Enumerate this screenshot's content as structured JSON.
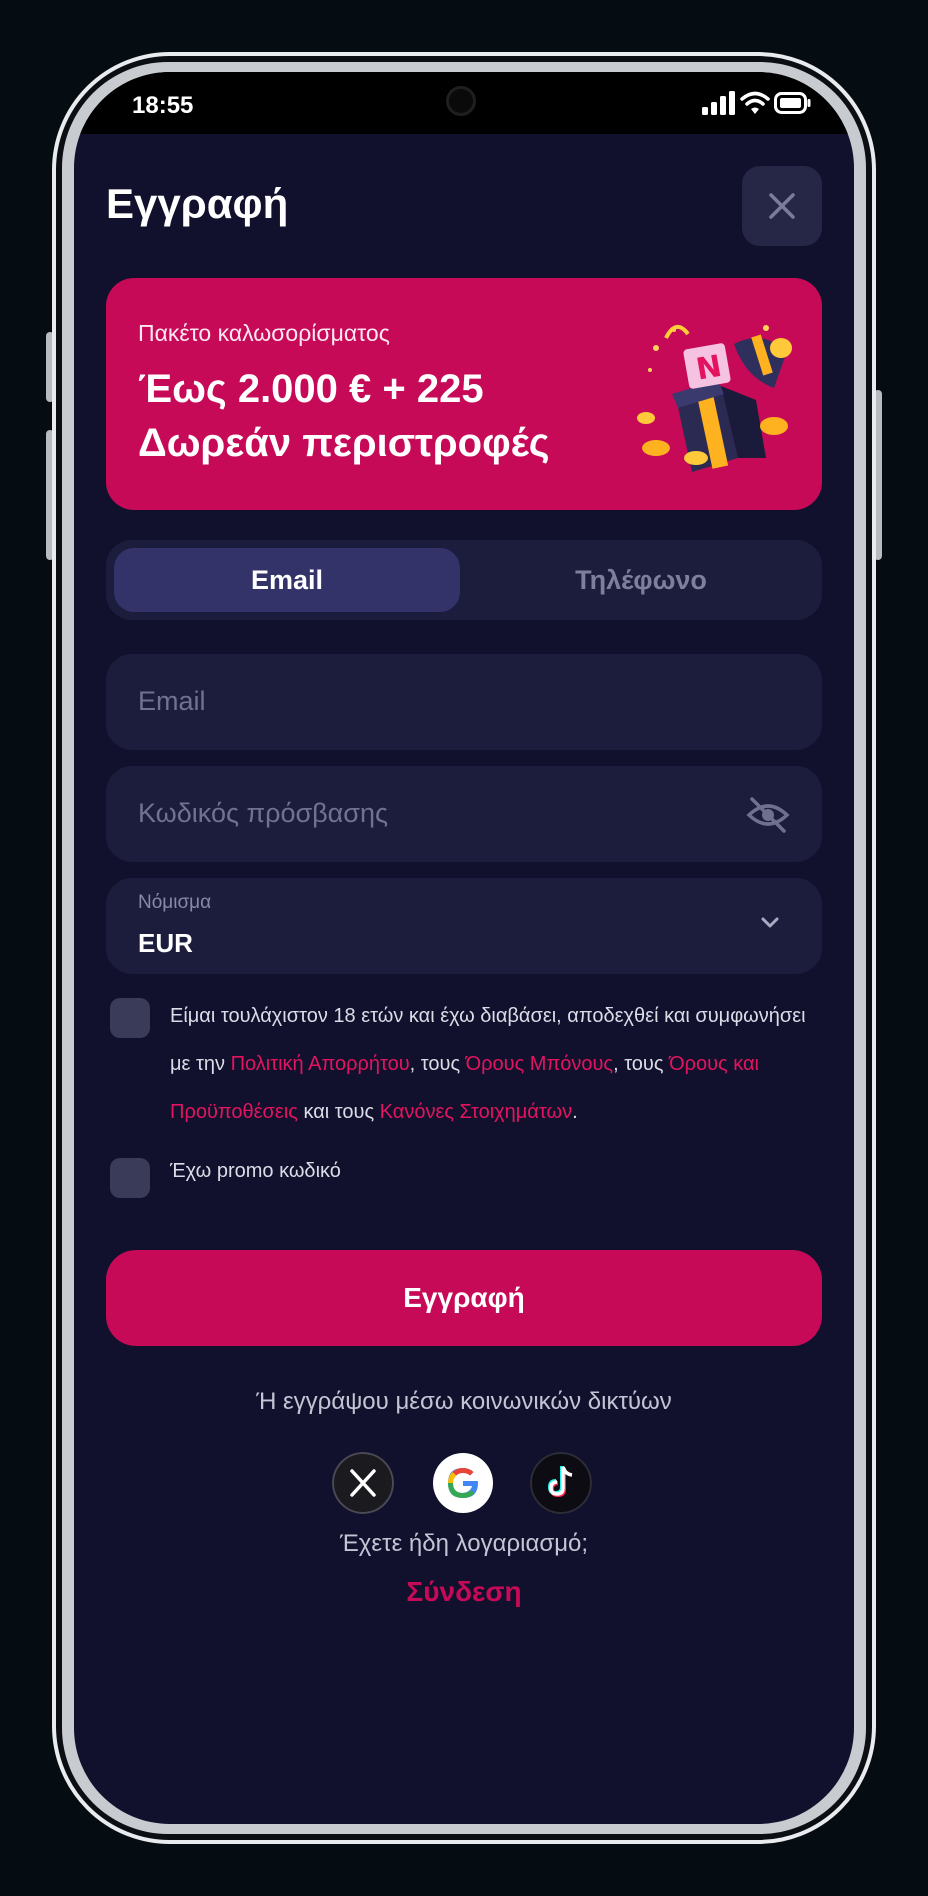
{
  "status": {
    "time": "18:55"
  },
  "header": {
    "title": "Εγγραφή"
  },
  "promo": {
    "subtitle": "Πακέτο καλωσορίσματος",
    "line1": "Έως 2.000 € + 225",
    "line2": "Δωρεάν περιστροφές"
  },
  "tabs": [
    {
      "label": "Email",
      "active": true
    },
    {
      "label": "Τηλέφωνο",
      "active": false
    }
  ],
  "form": {
    "email_placeholder": "Email",
    "password_placeholder": "Κωδικός πρόσβασης",
    "currency_label": "Νόμισμα",
    "currency_value": "EUR"
  },
  "terms": {
    "part1": "Είμαι τουλάχιστον 18 ετών και έχω διαβάσει, αποδεχθεί και συμφωνήσει με την ",
    "link_privacy": "Πολιτική Απορρήτου",
    "part2": ", τους ",
    "link_bonus": "Όρους Μπόνους",
    "part3": ", τους ",
    "link_terms": "Όρους και Προϋποθέσεις",
    "part4": " και τους ",
    "link_betting": "Κανόνες Στοιχημάτων",
    "part5": "."
  },
  "promo_code_label": "Έχω promo κωδικό",
  "submit_label": "Εγγραφή",
  "social": {
    "or_text": "Ή εγγράψου μέσω κοινωνικών δικτύων",
    "providers": [
      "x-icon",
      "google-icon",
      "tiktok-icon"
    ]
  },
  "footer": {
    "have_account": "Έχετε ήδη λογαριασμό;",
    "login_label": "Σύνδεση"
  },
  "colors": {
    "accent": "#c70a57",
    "background": "#11112d",
    "field": "#1c1c3d"
  }
}
